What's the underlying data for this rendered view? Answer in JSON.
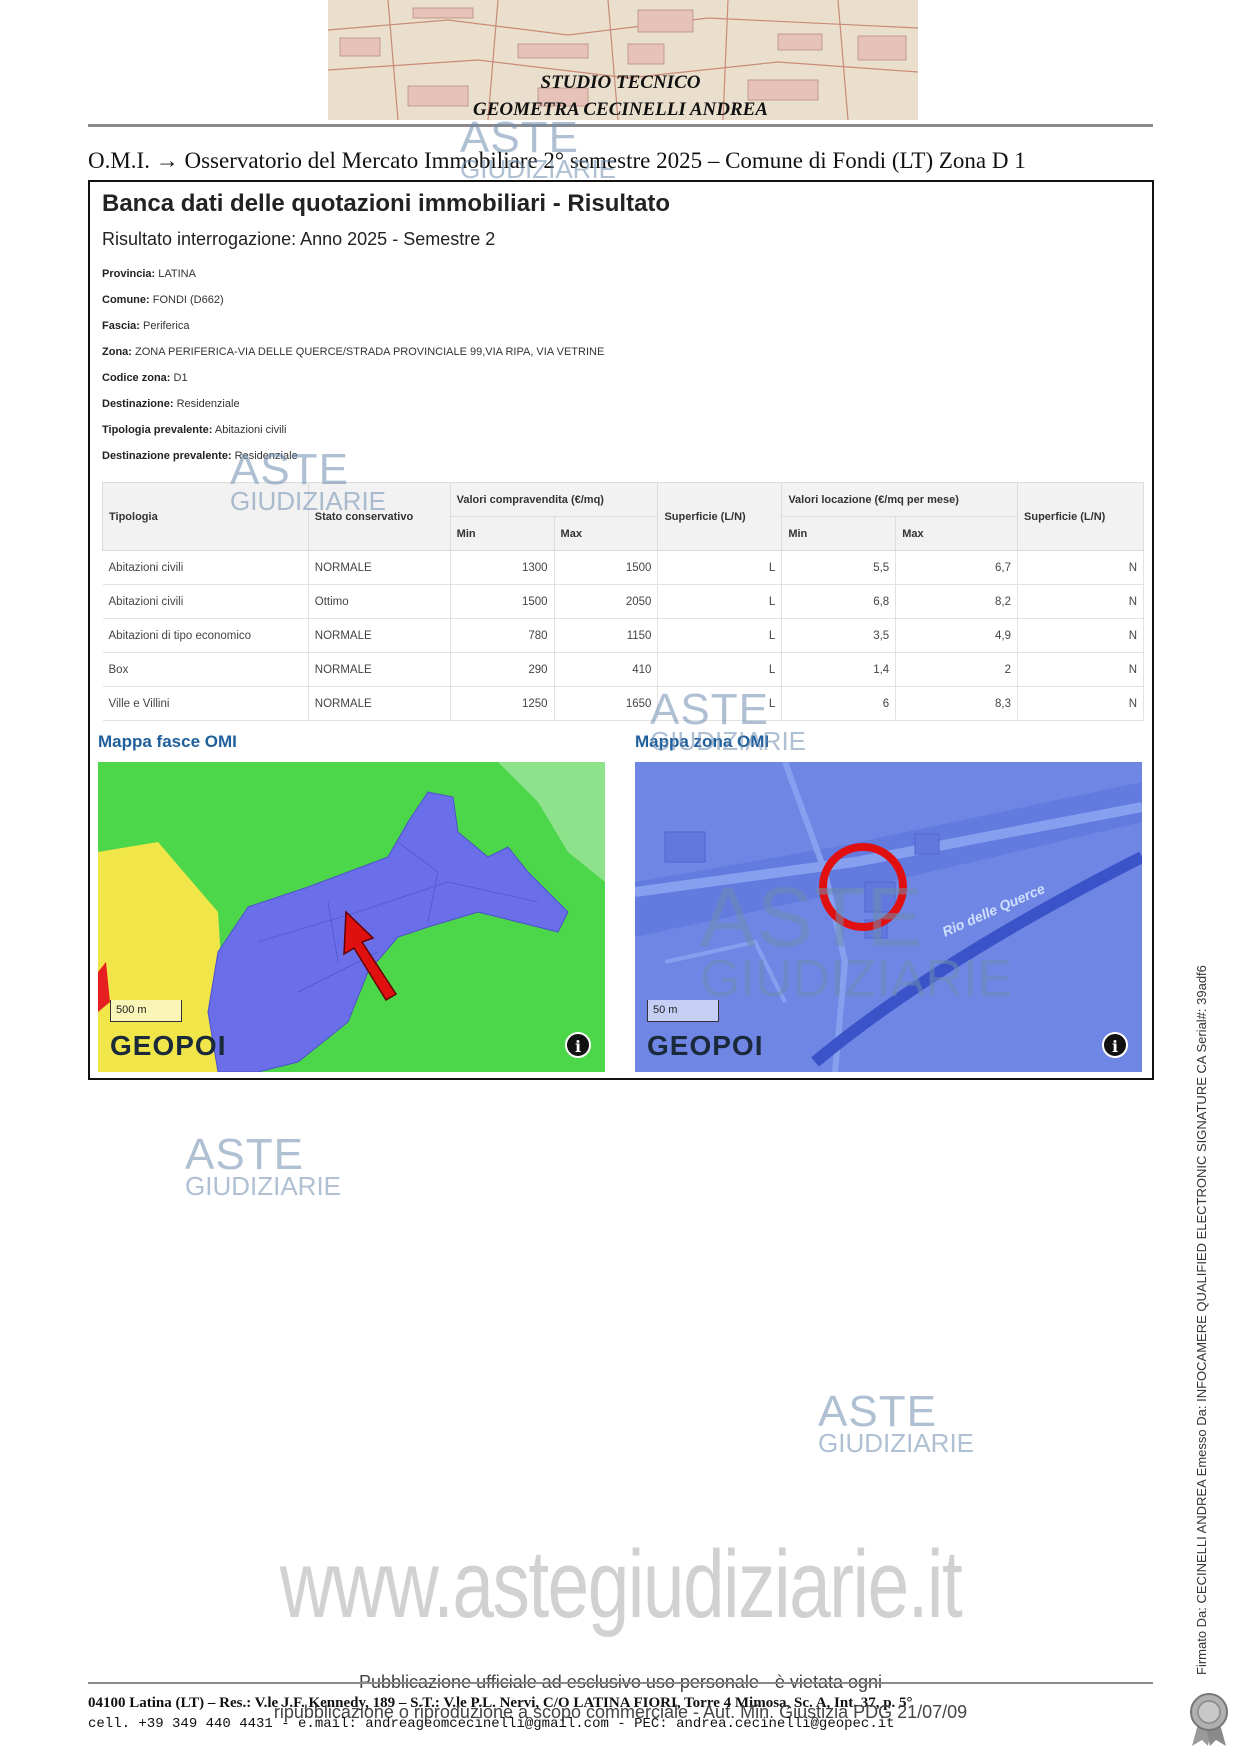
{
  "header": {
    "studio_line1": "STUDIO TECNICO",
    "studio_line2": "GEOMETRA CECINELLI ANDREA"
  },
  "omi_line": "O.M.I. → Osservatorio del Mercato Immobiliare 2° semestre 2025 – Comune di Fondi (LT) Zona D 1",
  "result": {
    "title": "Banca dati delle quotazioni immobiliari - Risultato",
    "subtitle": "Risultato interrogazione: Anno 2025 - Semestre 2",
    "fields": [
      {
        "label": "Provincia:",
        "value": "LATINA"
      },
      {
        "label": "Comune:",
        "value": "FONDI (D662)"
      },
      {
        "label": "Fascia:",
        "value": "Periferica"
      },
      {
        "label": "Zona:",
        "value": "ZONA PERIFERICA-VIA DELLE QUERCE/STRADA PROVINCIALE 99,VIA RIPA, VIA VETRINE"
      },
      {
        "label": "Codice zona:",
        "value": "D1"
      },
      {
        "label": "Destinazione:",
        "value": "Residenziale"
      },
      {
        "label": "Tipologia prevalente:",
        "value": "Abitazioni civili"
      },
      {
        "label": "Destinazione prevalente:",
        "value": "Residenziale"
      }
    ]
  },
  "table": {
    "headers": {
      "tipologia": "Tipologia",
      "stato": "Stato conservativo",
      "vendita": "Valori compravendita (€/mq)",
      "superficie1": "Superficie (L/N)",
      "locazione": "Valori locazione (€/mq per mese)",
      "superficie2": "Superficie (L/N)",
      "min": "Min",
      "max": "Max"
    },
    "rows": [
      {
        "tipologia": "Abitazioni civili",
        "stato": "NORMALE",
        "v_min": "1300",
        "v_max": "1500",
        "sup1": "L",
        "l_min": "5,5",
        "l_max": "6,7",
        "sup2": "N"
      },
      {
        "tipologia": "Abitazioni civili",
        "stato": "Ottimo",
        "v_min": "1500",
        "v_max": "2050",
        "sup1": "L",
        "l_min": "6,8",
        "l_max": "8,2",
        "sup2": "N"
      },
      {
        "tipologia": "Abitazioni di tipo economico",
        "stato": "NORMALE",
        "v_min": "780",
        "v_max": "1150",
        "sup1": "L",
        "l_min": "3,5",
        "l_max": "4,9",
        "sup2": "N"
      },
      {
        "tipologia": "Box",
        "stato": "NORMALE",
        "v_min": "290",
        "v_max": "410",
        "sup1": "L",
        "l_min": "1,4",
        "l_max": "2",
        "sup2": "N"
      },
      {
        "tipologia": "Ville e Villini",
        "stato": "NORMALE",
        "v_min": "1250",
        "v_max": "1650",
        "sup1": "L",
        "l_min": "6",
        "l_max": "8,3",
        "sup2": "N"
      }
    ]
  },
  "maps": {
    "left": {
      "title": "Mappa fasce OMI",
      "scale": "500 m",
      "brand": "GEOPOI",
      "info_icon": "info-icon"
    },
    "right": {
      "title": "Mappa zona OMI",
      "scale": "50 m",
      "brand": "GEOPOI",
      "road_label": "Rio delle Querce",
      "info_icon": "info-icon"
    }
  },
  "watermark": {
    "line1": "ASTE",
    "line2": "GIUDIZIARIE",
    "site": "www.astegiudiziarie.it",
    "color": "#6e8caf"
  },
  "publication": {
    "line1": "Pubblicazione ufficiale ad esclusivo uso personale - è vietata ogni",
    "line2": "ripubblicazione o riproduzione a scopo commerciale - Aut. Min. Giustizia PDG 21/07/09"
  },
  "footer": {
    "line1": "04100 Latina (LT) – Res.: V.le J.F. Kennedy, 189 – S.T.: V.le P.L. Nervi, C/O LATINA FIORI, Torre 4 Mimosa, Sc. A, Int. 37, p. 5°",
    "line2": "cell. +39 349 440 4431 - e.mail: andreageomcecinelli@gmail.com - PEC: andrea.cecinelli@geopec.it"
  },
  "signature": "Firmato Da: CECINELLI ANDREA Emesso Da: INFOCAMERE QUALIFIED ELECTRONIC SIGNATURE CA Serial#: 39adf6",
  "colors": {
    "zone_purple": "#6a6ee8",
    "green": "#4cd64a",
    "yellow": "#f0e64a",
    "arrow_red": "#e01010",
    "title_blue": "#1f5f9c"
  }
}
